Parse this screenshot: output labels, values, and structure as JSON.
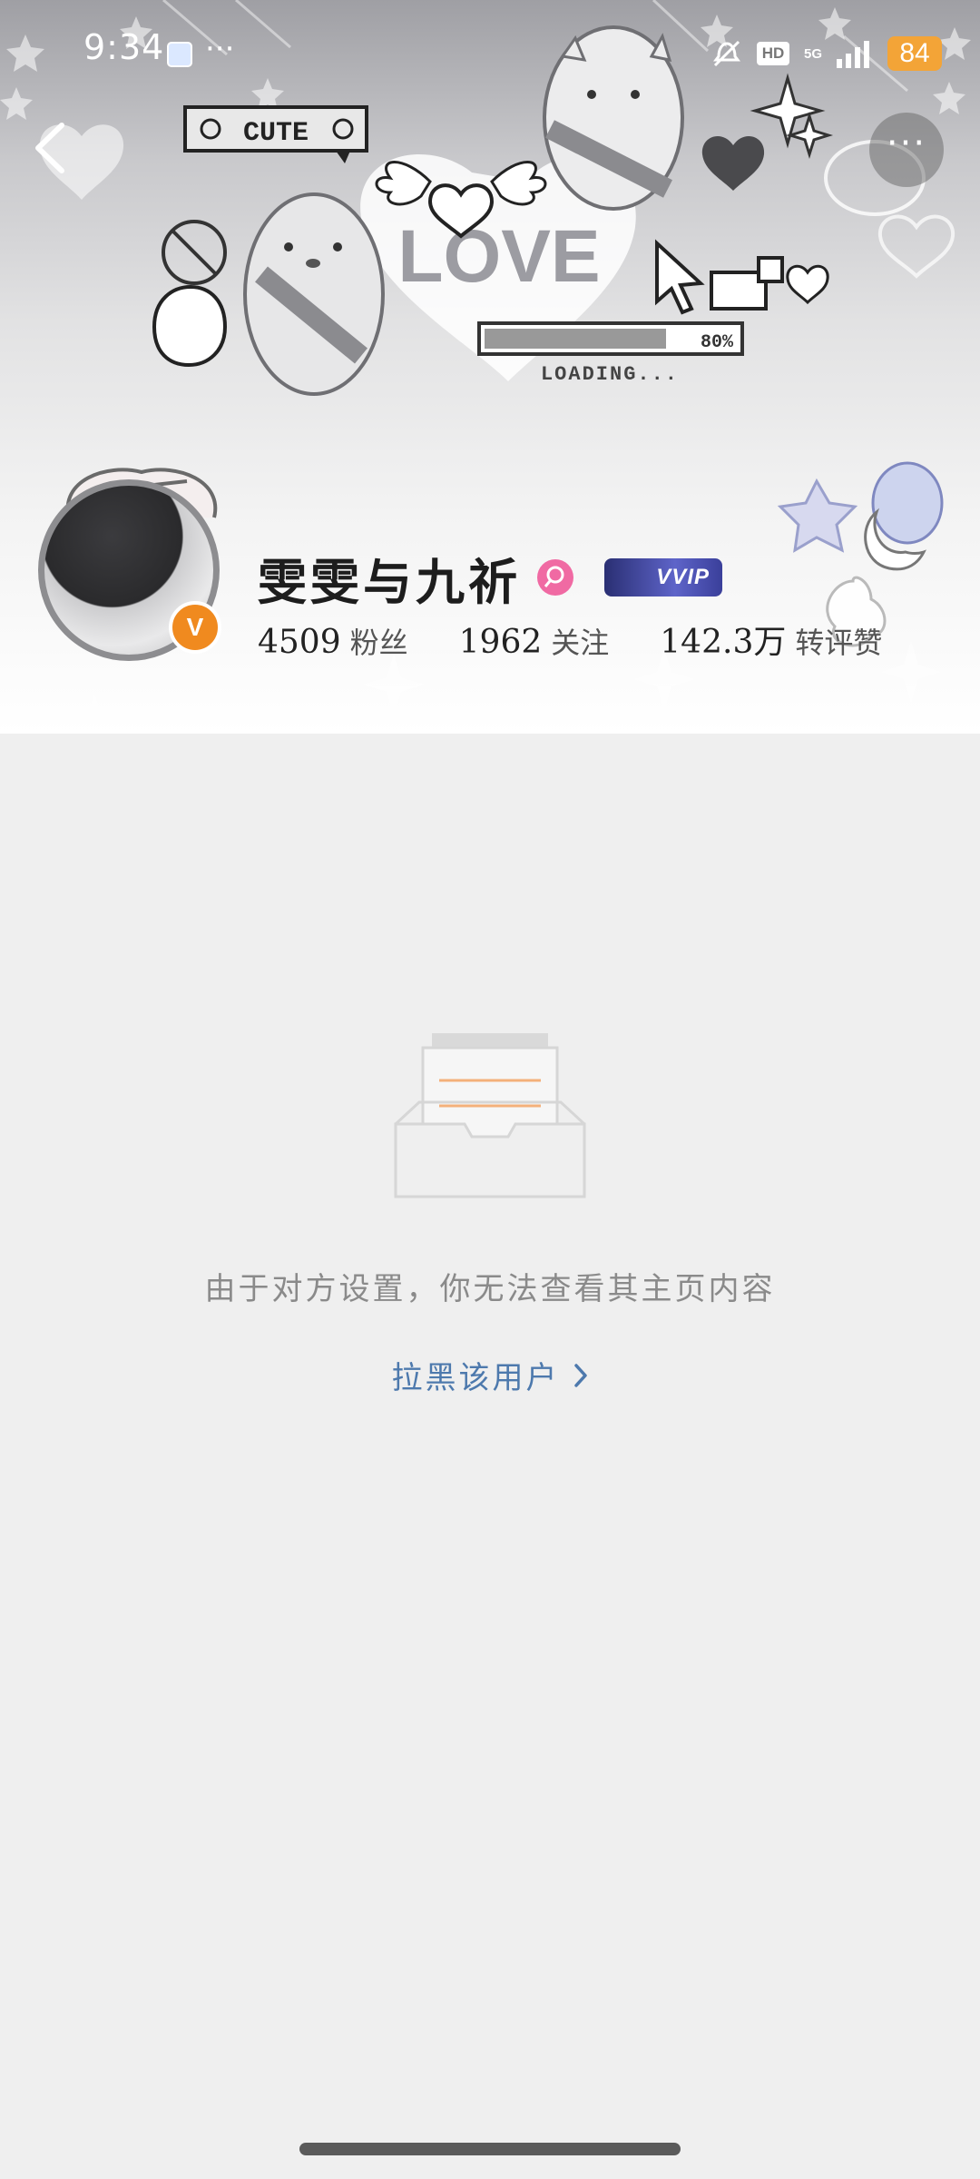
{
  "status_bar": {
    "time": "9:34",
    "overflow_dots": "···",
    "hd_label": "HD",
    "network_label": "5G",
    "battery_level": "84"
  },
  "header": {
    "cover_labels": {
      "cute": "CUTE",
      "love": "LOVE",
      "loading": "LOADING...",
      "progress": "80%"
    },
    "more_label": "···"
  },
  "profile": {
    "name": "雯雯与九祈",
    "verified_label": "V",
    "vip_label": "VVIP",
    "stats": [
      {
        "value": "4509",
        "label": "粉丝"
      },
      {
        "value": "1962",
        "label": "关注"
      },
      {
        "value": "142.3万",
        "label": "转评赞"
      }
    ]
  },
  "content": {
    "notice": "由于对方设置，你无法查看其主页内容",
    "block_link": "拉黑该用户"
  },
  "colors": {
    "accent_orange": "#f08a1f",
    "link_blue": "#4d79ad",
    "battery_orange": "#f3a437",
    "gender_pink": "#f06aa3"
  }
}
